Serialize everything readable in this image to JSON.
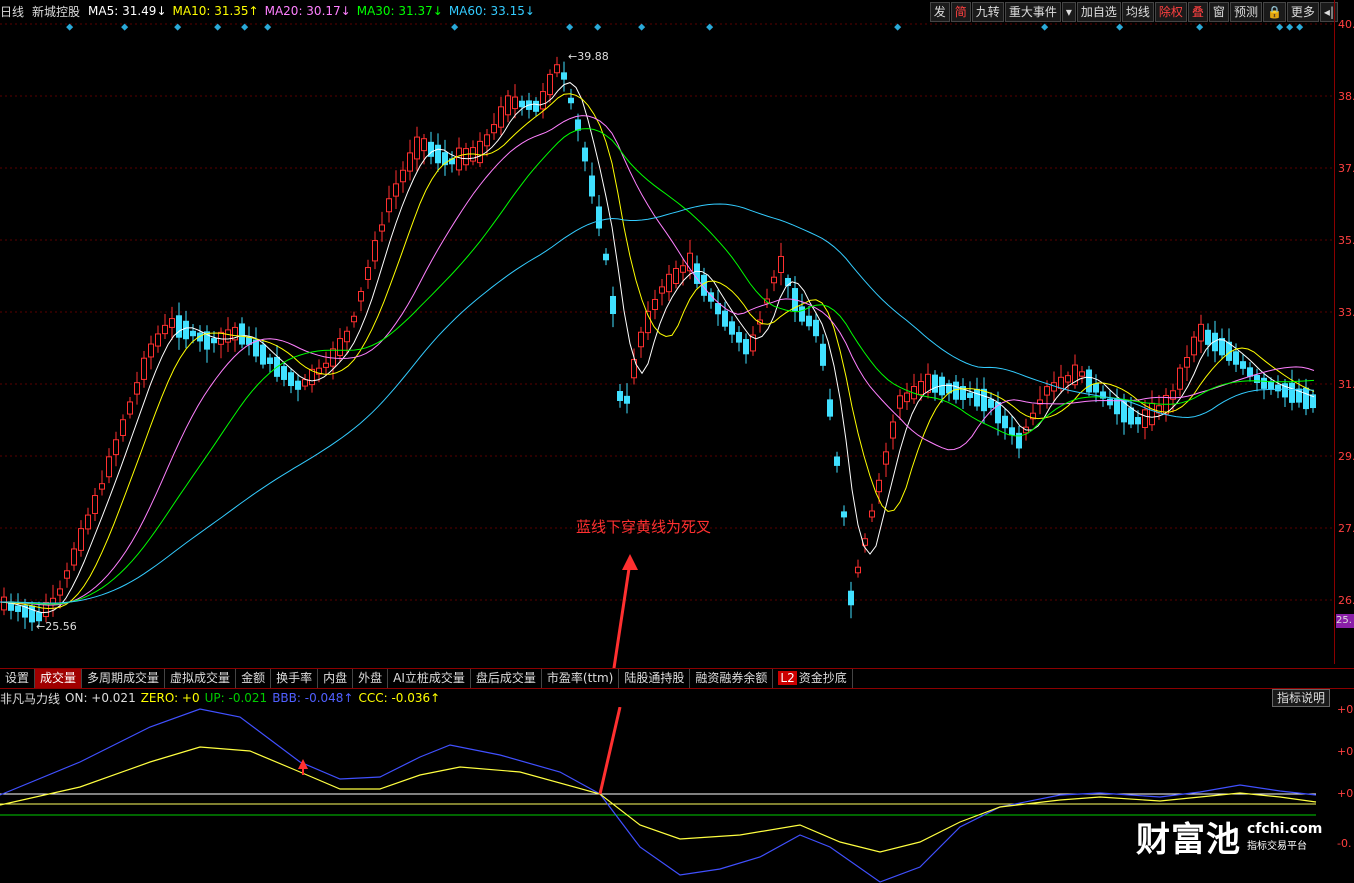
{
  "header": {
    "period_label": "日线",
    "stock_name": "新城控股",
    "ma": [
      {
        "text": "MA5: 31.49↓",
        "color": "#ffffff"
      },
      {
        "text": "MA10: 31.35↑",
        "color": "#ffff00"
      },
      {
        "text": "MA20: 30.17↓",
        "color": "#ff80ff"
      },
      {
        "text": "MA30: 31.37↓",
        "color": "#00ff00"
      },
      {
        "text": "MA60: 33.15↓",
        "color": "#33ccff"
      }
    ]
  },
  "toolbar": [
    "发",
    "简",
    "九转",
    "重大事件",
    "▾",
    "加自选",
    "均线",
    "除权",
    "叠",
    "窗",
    "预测",
    "🔒",
    "更多",
    "◂|"
  ],
  "price_axis": {
    "ticks": [
      "40.",
      "38.",
      "37.",
      "35.",
      "33.",
      "31.",
      "29.",
      "27.",
      "26."
    ],
    "last": "25."
  },
  "annotations": {
    "high": "39.88",
    "low": "25.56",
    "note": "蓝线下穿黄线为死叉"
  },
  "tabs": [
    "设置",
    "成交量",
    "多周期成交量",
    "虚拟成交量",
    "金额",
    "换手率",
    "内盘",
    "外盘",
    "AI立桩成交量",
    "盘后成交量",
    "市盈率(ttm)",
    "陆股通持股",
    "融资融券余额",
    "资金抄底"
  ],
  "tabs_l2": "L2",
  "indicator": {
    "name": "非凡马力线",
    "values": [
      {
        "text": "ON: +0.021",
        "color": "#dddddd"
      },
      {
        "text": "ZERO: +0",
        "color": "#ffff00"
      },
      {
        "text": "UP: -0.021",
        "color": "#00cc00"
      },
      {
        "text": "BBB: -0.048↑",
        "color": "#5060ff"
      },
      {
        "text": "CCC: -0.036↑",
        "color": "#ffff00"
      }
    ],
    "button": "指标说明",
    "axis_ticks": [
      "+0.",
      "+0.",
      "+0.",
      "-0."
    ]
  },
  "watermark": {
    "logo": "财富池",
    "domain": "cfchi.com",
    "tagline": "指标交易平台"
  }
}
